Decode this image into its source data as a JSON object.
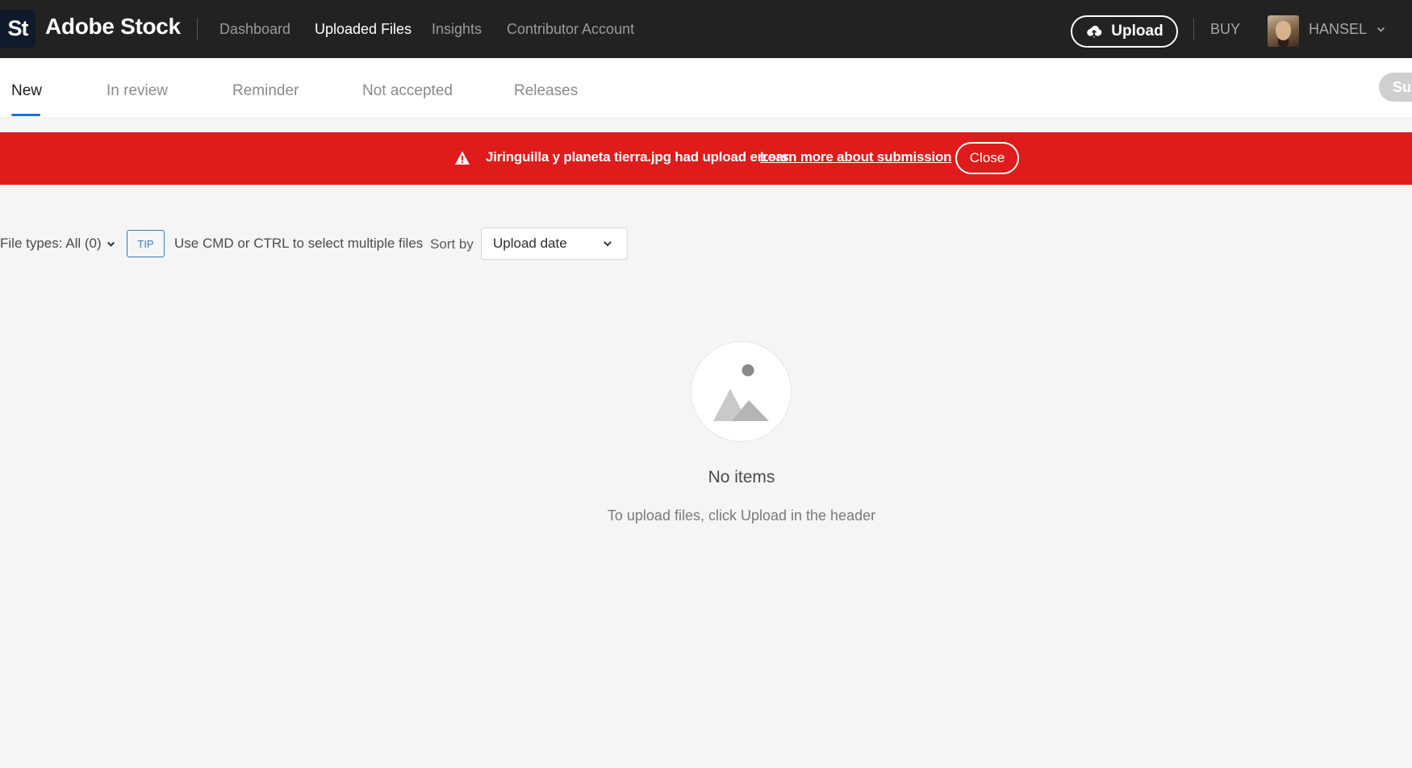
{
  "header": {
    "logo_text": "St",
    "brand": "Adobe Stock",
    "nav": [
      {
        "label": "Dashboard"
      },
      {
        "label": "Uploaded Files"
      },
      {
        "label": "Insights"
      },
      {
        "label": "Contributor Account"
      }
    ],
    "upload_label": "Upload",
    "buy_label": "BUY",
    "username": "HANSEL"
  },
  "tabs": [
    {
      "label": "New"
    },
    {
      "label": "In review"
    },
    {
      "label": "Reminder"
    },
    {
      "label": "Not accepted"
    },
    {
      "label": "Releases"
    }
  ],
  "submit_button": {
    "label": "Sub"
  },
  "banner": {
    "message": "Jiringuilla y planeta tierra.jpg had upload errors.",
    "link": "Learn more about submission",
    "close_label": "Close",
    "color": "#e01b1b"
  },
  "toolbar": {
    "file_types": "File types: All (0)",
    "tip_badge": "TIP",
    "tip_text": "Use CMD or CTRL to select multiple files",
    "sort_by_label": "Sort by",
    "sort_value": "Upload date"
  },
  "empty_state": {
    "icon": "image-placeholder-icon",
    "title": "No items",
    "subtitle": "To upload files, click Upload in the header"
  },
  "colors": {
    "header_bg": "#222222",
    "accent": "#1473e6",
    "error": "#e01b1b"
  }
}
